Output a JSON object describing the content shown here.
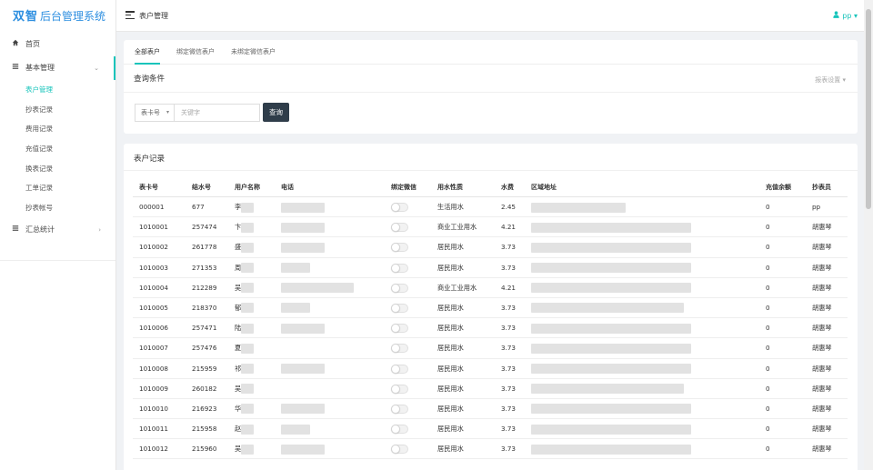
{
  "app": {
    "logo_main": "双智",
    "logo_sub": "后台管理系统"
  },
  "header": {
    "page_title": "表户管理",
    "user_name": "pp",
    "user_caret": "▾"
  },
  "sidebar": {
    "home_label": "首页",
    "basic_label": "基本管理",
    "basic_arrow": "⌄",
    "sub_items": [
      "表户管理",
      "抄表记录",
      "费用记录",
      "充值记录",
      "换表记录",
      "工单记录",
      "抄表帐号"
    ],
    "stats_label": "汇总统计",
    "stats_arrow": "›"
  },
  "tabs": [
    "全部表户",
    "绑定微信表户",
    "未绑定微信表户"
  ],
  "query": {
    "title": "查询条件",
    "report_settings": "报表设置 ▾",
    "select_value": "表卡号",
    "input_placeholder": "关键字",
    "button_label": "查询"
  },
  "records": {
    "title": "表户记录",
    "columns": [
      "表卡号",
      "结水号",
      "用户名称",
      "电话",
      "绑定微信",
      "用水性质",
      "水费",
      "区域地址",
      "充值余额",
      "抄表员"
    ],
    "rows": [
      {
        "card": "000001",
        "meter": "677",
        "name": "李",
        "type": "生活用水",
        "fee": "2.45",
        "balance": "0",
        "reader": "pp"
      },
      {
        "card": "1010001",
        "meter": "257474",
        "name": "卞",
        "type": "商业工业用水",
        "fee": "4.21",
        "balance": "0",
        "reader": "胡惠琴"
      },
      {
        "card": "1010002",
        "meter": "261778",
        "name": "盛",
        "type": "居民用水",
        "fee": "3.73",
        "balance": "0",
        "reader": "胡惠琴"
      },
      {
        "card": "1010003",
        "meter": "271353",
        "name": "周",
        "type": "居民用水",
        "fee": "3.73",
        "balance": "0",
        "reader": "胡惠琴"
      },
      {
        "card": "1010004",
        "meter": "212289",
        "name": "吴",
        "type": "商业工业用水",
        "fee": "4.21",
        "balance": "0",
        "reader": "胡惠琴"
      },
      {
        "card": "1010005",
        "meter": "218370",
        "name": "郁",
        "type": "居民用水",
        "fee": "3.73",
        "balance": "0",
        "reader": "胡惠琴"
      },
      {
        "card": "1010006",
        "meter": "257471",
        "name": "陆",
        "type": "居民用水",
        "fee": "3.73",
        "balance": "0",
        "reader": "胡惠琴"
      },
      {
        "card": "1010007",
        "meter": "257476",
        "name": "夏",
        "type": "居民用水",
        "fee": "3.73",
        "balance": "0",
        "reader": "胡惠琴"
      },
      {
        "card": "1010008",
        "meter": "215959",
        "name": "祁",
        "type": "居民用水",
        "fee": "3.73",
        "balance": "0",
        "reader": "胡惠琴"
      },
      {
        "card": "1010009",
        "meter": "260182",
        "name": "吴",
        "type": "居民用水",
        "fee": "3.73",
        "balance": "0",
        "reader": "胡惠琴"
      },
      {
        "card": "1010010",
        "meter": "216923",
        "name": "华",
        "type": "居民用水",
        "fee": "3.73",
        "balance": "0",
        "reader": "胡惠琴"
      },
      {
        "card": "1010011",
        "meter": "215958",
        "name": "赵",
        "type": "居民用水",
        "fee": "3.73",
        "balance": "0",
        "reader": "胡惠琴"
      },
      {
        "card": "1010012",
        "meter": "215960",
        "name": "吴",
        "type": "居民用水",
        "fee": "3.73",
        "balance": "0",
        "reader": "胡惠琴"
      }
    ]
  },
  "colors": {
    "accent": "#17c4bb",
    "logo": "#2e8fe0",
    "button": "#2f3d4a"
  }
}
